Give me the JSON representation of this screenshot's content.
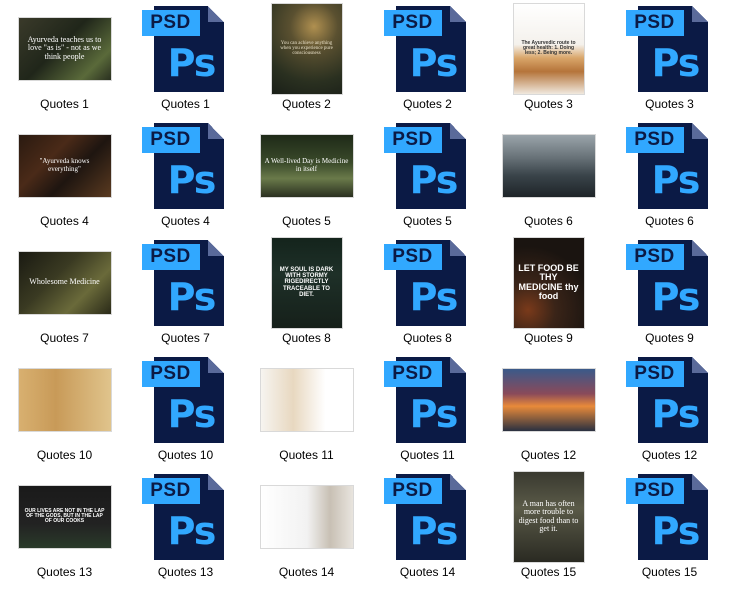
{
  "files": [
    {
      "kind": "photo",
      "label": "Quotes 1",
      "orient": "land",
      "bg": "linear-gradient(135deg,#3a3a2a 0%,#20261a 45%,#5a6a3a 80%,#2a3020 100%)",
      "text": "Ayurveda teaches us to love \"as is\" - not as we think people",
      "textColor": "#ffffff",
      "fs": "8px",
      "font": "serif"
    },
    {
      "kind": "psd",
      "label": "Quotes 1"
    },
    {
      "kind": "photo",
      "label": "Quotes 2",
      "orient": "port",
      "bg": "radial-gradient(circle at 60% 25%,#b09050 0%,#5a5030 30%,#2a3020 70%,#1a1f18 100%)",
      "text": "You can achieve anything when you experience pure consciousness",
      "textColor": "#e8e0c8",
      "fs": "5px",
      "font": "serif"
    },
    {
      "kind": "psd",
      "label": "Quotes 2"
    },
    {
      "kind": "photo",
      "label": "Quotes 3",
      "orient": "port",
      "bg": "linear-gradient(180deg,#ffffff 0%,#f4f1ec 45%,#d9a66a 60%,#b5743a 75%,#f0e8de 100%)",
      "text": "The Ayurvedic route to great health: 1. Doing less; 2. Being more.",
      "textColor": "#333333",
      "fs": "5px",
      "font": "sans"
    },
    {
      "kind": "psd",
      "label": "Quotes 3"
    },
    {
      "kind": "photo",
      "label": "Quotes 4",
      "orient": "land",
      "bg": "linear-gradient(135deg,#2a1a10 0%,#4a2a18 35%,#1e1510 60%,#5a3a20 100%)",
      "text": "\"Ayurveda knows everything\"",
      "textColor": "#ffffff",
      "fs": "7px",
      "font": "serif"
    },
    {
      "kind": "psd",
      "label": "Quotes 4"
    },
    {
      "kind": "photo",
      "label": "Quotes 5",
      "orient": "land",
      "bg": "linear-gradient(180deg,#1e2a18 0%,#3a4a2a 45%,#6a7a4a 70%,#2a3020 100%)",
      "text": "A Well-lived Day is Medicine in itself",
      "textColor": "#ffffff",
      "fs": "7px",
      "font": "serif"
    },
    {
      "kind": "psd",
      "label": "Quotes 5"
    },
    {
      "kind": "photo",
      "label": "Quotes 6",
      "orient": "land",
      "bg": "linear-gradient(180deg,#9aa4aa 0%,#6a747a 35%,#3a444a 65%,#1e2428 100%)",
      "text": "",
      "textColor": "#ffffff",
      "fs": "5px",
      "font": "sans"
    },
    {
      "kind": "psd",
      "label": "Quotes 6"
    },
    {
      "kind": "photo",
      "label": "Quotes 7",
      "orient": "land",
      "bg": "linear-gradient(135deg,#1a1a12 0%,#3a3a22 40%,#6a6a3a 70%,#2a2a18 100%)",
      "text": "Wholesome Medicine",
      "textColor": "#ffffff",
      "fs": "8px",
      "font": "serif"
    },
    {
      "kind": "psd",
      "label": "Quotes 7"
    },
    {
      "kind": "photo",
      "label": "Quotes 8",
      "orient": "port",
      "bg": "linear-gradient(180deg,#14241c 0%,#1e3028 40%,#16201a 100%)",
      "text": "MY SOUL IS DARK WITH STORMY RIGEDIRECTLY TRACEABLE TO DIET.",
      "textColor": "#ffffff",
      "fs": "6px",
      "font": "sans"
    },
    {
      "kind": "psd",
      "label": "Quotes 8"
    },
    {
      "kind": "photo",
      "label": "Quotes 9",
      "orient": "port",
      "bg": "radial-gradient(circle at 20% 80%,#7a3a1a 0%,#3a2418 30%,#1a1410 70%)",
      "text": "LET FOOD BE THY MEDICINE thy food",
      "textColor": "#ffffff",
      "fs": "9px",
      "font": "sans"
    },
    {
      "kind": "psd",
      "label": "Quotes 9"
    },
    {
      "kind": "photo",
      "label": "Quotes 10",
      "orient": "land",
      "bg": "linear-gradient(90deg,#d8b070 0%,#c89a58 40%,#e0c48c 100%)",
      "text": "",
      "textColor": "#ffffff",
      "fs": "4px",
      "font": "sans"
    },
    {
      "kind": "psd",
      "label": "Quotes 10"
    },
    {
      "kind": "photo",
      "label": "Quotes 11",
      "orient": "land",
      "bg": "linear-gradient(90deg,#f6f4f0 0%,#e8d8c0 35%,#ffffff 70%)",
      "text": "",
      "textColor": "#555555",
      "fs": "4px",
      "font": "sans"
    },
    {
      "kind": "psd",
      "label": "Quotes 11"
    },
    {
      "kind": "photo",
      "label": "Quotes 12",
      "orient": "land",
      "bg": "linear-gradient(180deg,#3a5a8a 0%,#8a4a5a 40%,#e88a3a 60%,#2a3040 100%)",
      "text": "",
      "textColor": "#ffffff",
      "fs": "4px",
      "font": "sans"
    },
    {
      "kind": "psd",
      "label": "Quotes 12"
    },
    {
      "kind": "photo",
      "label": "Quotes 13",
      "orient": "land",
      "bg": "linear-gradient(180deg,#1a1a1a 0%,#222222 60%,#2a3a2a 100%)",
      "text": "OUR LIVES ARE NOT IN THE LAP OF THE GODS, BUT IN THE LAP OF OUR COOKS",
      "textColor": "#ffffff",
      "fs": "5px",
      "font": "sans"
    },
    {
      "kind": "psd",
      "label": "Quotes 13"
    },
    {
      "kind": "photo",
      "label": "Quotes 14",
      "orient": "land",
      "bg": "linear-gradient(90deg,#ffffff 0%,#f2f2f2 50%,#c8c0b4 75%,#e8e4de 100%)",
      "text": "",
      "textColor": "#444444",
      "fs": "4px",
      "font": "sans"
    },
    {
      "kind": "psd",
      "label": "Quotes 14"
    },
    {
      "kind": "photo",
      "label": "Quotes 15",
      "orient": "port",
      "bg": "linear-gradient(180deg,#3a3a30 0%,#5a5a48 40%,#2a2a22 100%)",
      "text": "A man has often more trouble to digest food than to get it.",
      "textColor": "#ffffff",
      "fs": "8px",
      "font": "serif"
    },
    {
      "kind": "psd",
      "label": "Quotes 15"
    }
  ],
  "psd_badge": "PSD",
  "ps_mark": "Ps"
}
